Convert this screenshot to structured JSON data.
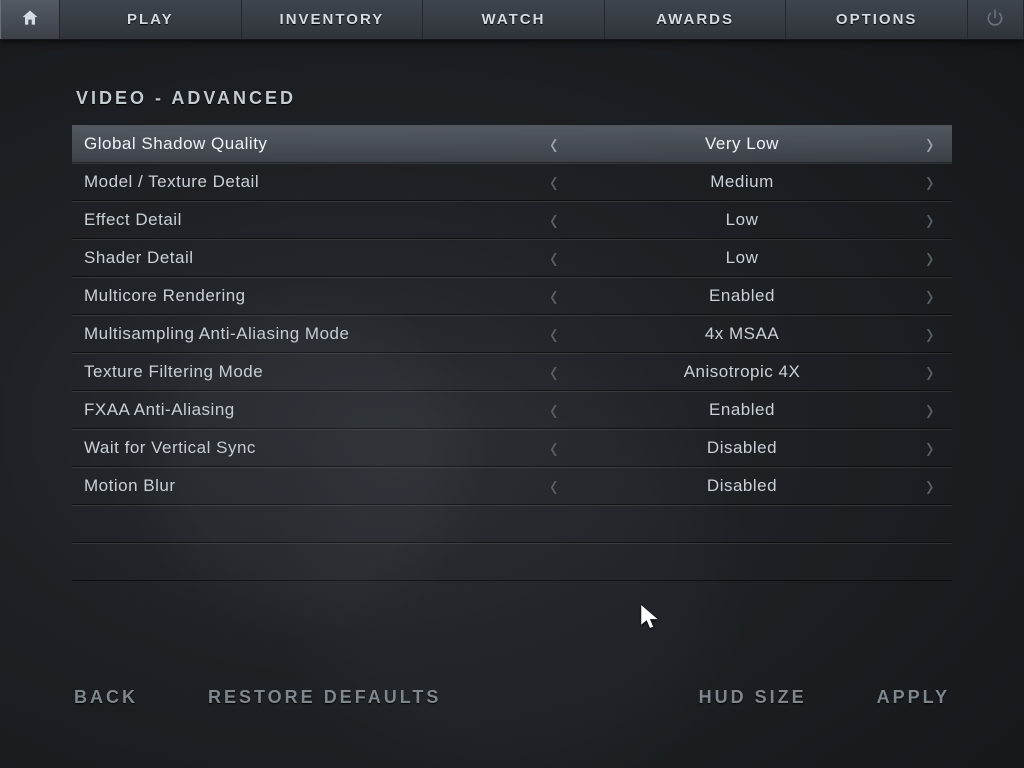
{
  "nav": {
    "tabs": [
      "PLAY",
      "INVENTORY",
      "WATCH",
      "AWARDS",
      "OPTIONS"
    ]
  },
  "page": {
    "title": "VIDEO - ADVANCED"
  },
  "settings": [
    {
      "label": "Global Shadow Quality",
      "value": "Very Low",
      "highlight": true
    },
    {
      "label": "Model / Texture Detail",
      "value": "Medium",
      "highlight": false
    },
    {
      "label": "Effect Detail",
      "value": "Low",
      "highlight": false
    },
    {
      "label": "Shader Detail",
      "value": "Low",
      "highlight": false
    },
    {
      "label": "Multicore Rendering",
      "value": "Enabled",
      "highlight": false
    },
    {
      "label": "Multisampling Anti-Aliasing Mode",
      "value": "4x MSAA",
      "highlight": false
    },
    {
      "label": "Texture Filtering Mode",
      "value": "Anisotropic 4X",
      "highlight": false
    },
    {
      "label": "FXAA Anti-Aliasing",
      "value": "Enabled",
      "highlight": false
    },
    {
      "label": "Wait for Vertical Sync",
      "value": "Disabled",
      "highlight": false
    },
    {
      "label": "Motion Blur",
      "value": "Disabled",
      "highlight": false
    }
  ],
  "footer": {
    "back": "BACK",
    "restore": "RESTORE DEFAULTS",
    "hud": "HUD SIZE",
    "apply": "APPLY"
  }
}
